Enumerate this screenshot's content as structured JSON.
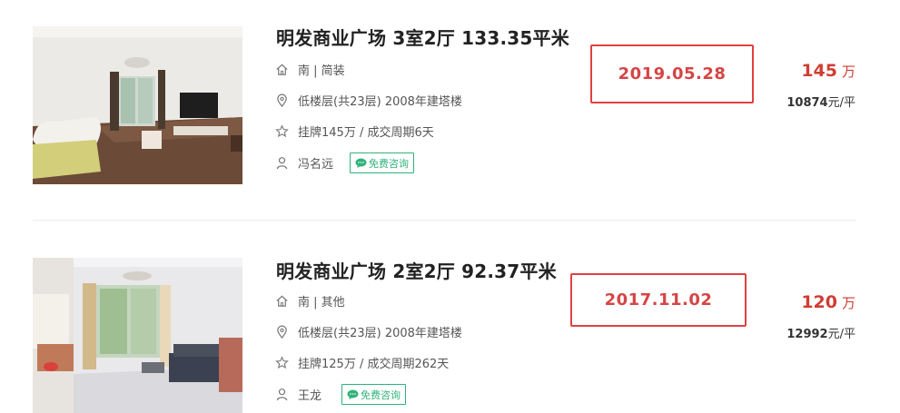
{
  "listings": [
    {
      "title": "明发商业广场 3室2厅 133.35平米",
      "orientation_decor": "南 | 简装",
      "floor_info": "低楼层(共23层) 2008年建塔楼",
      "listing_info": "挂牌145万 / 成交周期6天",
      "agent": "冯名远",
      "consult_label": "免费咨询",
      "deal_date": "2019.05.28",
      "total_price": "145",
      "total_price_unit": "万",
      "unit_price": "10874",
      "unit_price_unit": "元/平"
    },
    {
      "title": "明发商业广场 2室2厅 92.37平米",
      "orientation_decor": "南 | 其他",
      "floor_info": "低楼层(共23层) 2008年建塔楼",
      "listing_info": "挂牌125万 / 成交周期262天",
      "agent": "王龙",
      "consult_label": "免费咨询",
      "deal_date": "2017.11.02",
      "total_price": "120",
      "total_price_unit": "万",
      "unit_price": "12992",
      "unit_price_unit": "元/平"
    }
  ],
  "colors": {
    "highlight_border": "#e04141",
    "price": "#d13d32",
    "consult_green": "#2fb37a"
  },
  "icons": {
    "orientation": "house-icon",
    "floor": "location-pin-icon",
    "listing": "star-icon",
    "agent": "user-icon",
    "consult": "chat-bubble-icon"
  }
}
